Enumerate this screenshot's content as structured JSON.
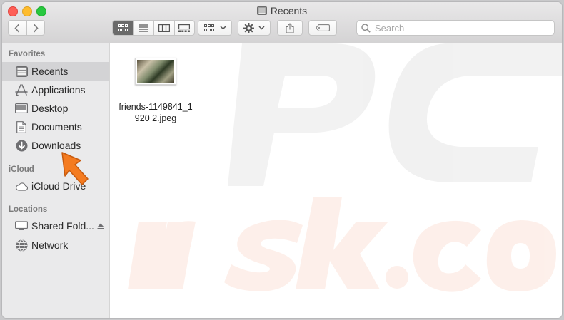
{
  "window": {
    "title": "Recents"
  },
  "toolbar": {
    "back_icon": "chevron-left-icon",
    "forward_icon": "chevron-right-icon",
    "view_modes": [
      "icon-view",
      "list-view",
      "column-view",
      "gallery-view"
    ],
    "active_view": "icon-view",
    "group_icon": "group-by-icon",
    "action_icon": "gear-icon",
    "share_icon": "share-icon",
    "tag_icon": "tag-icon"
  },
  "search": {
    "placeholder": "Search",
    "value": ""
  },
  "sidebar": {
    "sections": [
      {
        "label": "Favorites",
        "items": [
          {
            "label": "Recents",
            "icon": "recents-icon",
            "selected": true
          },
          {
            "label": "Applications",
            "icon": "applications-icon"
          },
          {
            "label": "Desktop",
            "icon": "desktop-icon"
          },
          {
            "label": "Documents",
            "icon": "documents-icon"
          },
          {
            "label": "Downloads",
            "icon": "downloads-icon"
          }
        ]
      },
      {
        "label": "iCloud",
        "items": [
          {
            "label": "iCloud Drive",
            "icon": "cloud-icon"
          }
        ]
      },
      {
        "label": "Locations",
        "items": [
          {
            "label": "Shared Fold...",
            "icon": "display-icon",
            "eject": true
          },
          {
            "label": "Network",
            "icon": "globe-icon"
          }
        ]
      }
    ]
  },
  "files": [
    {
      "name": "friends-1149841_1920 2.jpeg",
      "type": "jpeg"
    }
  ],
  "colors": {
    "selected_row": "#d3d3d5",
    "sidebar_bg": "#eaeaeb",
    "pointer_arrow": "#f47b20"
  }
}
